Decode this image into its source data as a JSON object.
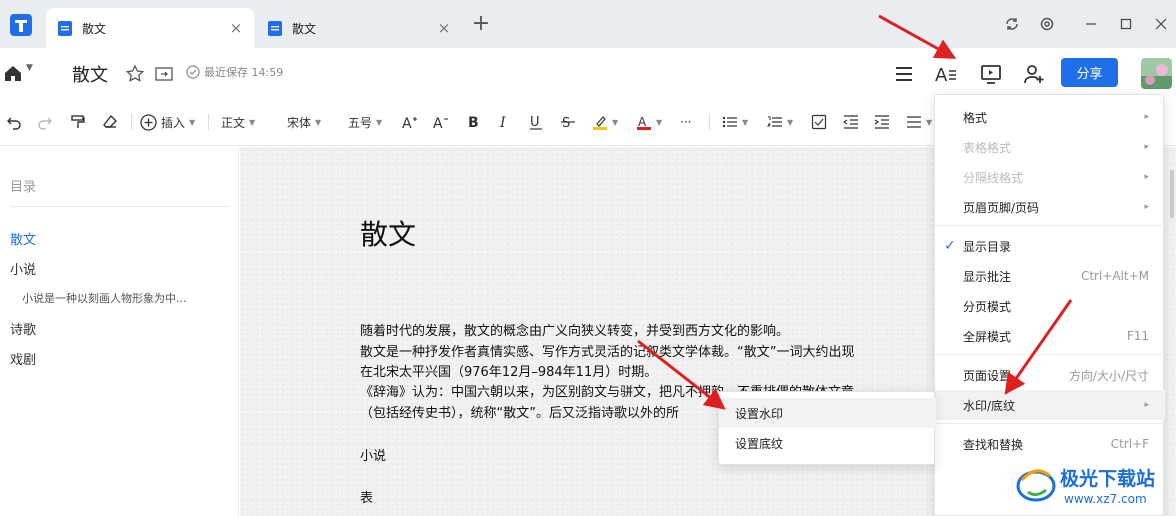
{
  "tabs": [
    {
      "label": "散文",
      "close": "×"
    },
    {
      "label": "散文",
      "close": "×"
    }
  ],
  "new_tab": "+",
  "header": {
    "doc_title": "散文",
    "save_status": "最近保存 14:59",
    "share_label": "分享"
  },
  "toolbar": {
    "insert_label": "插入",
    "style_value": "正文",
    "font_value": "宋体",
    "size_value": "五号",
    "more": "···"
  },
  "outline": {
    "heading": "目录",
    "items": [
      {
        "label": "散文"
      },
      {
        "label": "小说"
      },
      {
        "label": "小说是一种以刻画人物形象为中..."
      },
      {
        "label": "诗歌"
      },
      {
        "label": "戏剧"
      }
    ]
  },
  "document": {
    "title": "散文",
    "lines": [
      "随着时代的发展，散文的概念由广义向狭义转变，并受到西方文化的影响。",
      "散文是一种抒发作者真情实感、写作方式灵活的记叙类文学体裁。“散文”一词大约出现",
      "在北宋太平兴国（976年12月–984年11月）时期。",
      "《辞海》认为：中国六朝以来，为区别韵文与骈文，把凡不押韵、不重排偶的散体文章",
      "（包括经传史书），统称“散文”。后又泛指诗歌以外的所",
      "小说",
      "表"
    ]
  },
  "menu": {
    "items": [
      {
        "label": "格式",
        "submenu": true
      },
      {
        "label": "表格格式",
        "submenu": true,
        "disabled": true
      },
      {
        "label": "分隔线格式",
        "submenu": true,
        "disabled": true
      },
      {
        "label": "页眉页脚/页码",
        "submenu": true
      },
      {
        "label": "显示目录",
        "checked": true
      },
      {
        "label": "显示批注",
        "shortcut": "Ctrl+Alt+M"
      },
      {
        "label": "分页模式"
      },
      {
        "label": "全屏模式",
        "shortcut": "F11"
      },
      {
        "label": "页面设置",
        "shortcut": "方向/大小/尺寸"
      },
      {
        "label": "水印/底纹",
        "submenu": true
      },
      {
        "label": "查找和替换",
        "shortcut": "Ctrl+F"
      }
    ],
    "arrow_glyph": "▸",
    "check_glyph": "✓"
  },
  "submenu": {
    "items": [
      {
        "label": "设置水印"
      },
      {
        "label": "设置底纹"
      }
    ]
  },
  "watermark": {
    "name": "极光下载站",
    "url": "www.xz7.com"
  },
  "colors": {
    "accent": "#1f6feb",
    "annotation_arrow": "#e02020",
    "highlight": "#f5c518",
    "font_color": "#e02020"
  }
}
